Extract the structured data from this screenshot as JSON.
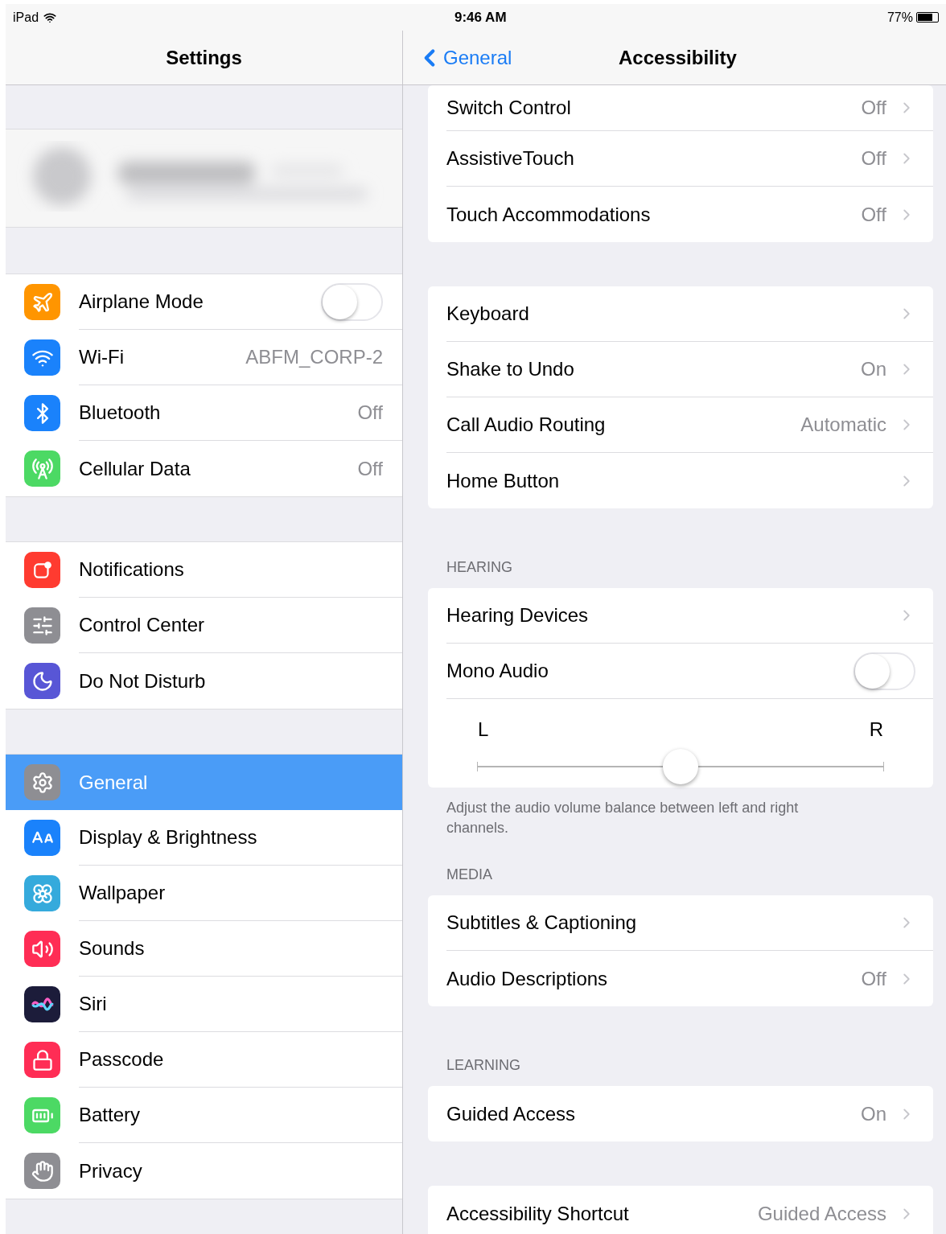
{
  "status_bar": {
    "device": "iPad",
    "time": "9:46 AM",
    "battery": "77%"
  },
  "sidebar": {
    "title": "Settings",
    "groups": [
      [
        {
          "kind": "toggle",
          "label": "Airplane Mode",
          "on": false,
          "selected": false
        },
        {
          "kind": "value",
          "label": "Wi-Fi",
          "value": "ABFM_CORP-2",
          "selected": false
        },
        {
          "kind": "value",
          "label": "Bluetooth",
          "value": "Off",
          "selected": false
        },
        {
          "kind": "value",
          "label": "Cellular Data",
          "value": "Off",
          "selected": false
        }
      ],
      [
        {
          "kind": "plain",
          "label": "Notifications",
          "selected": false
        },
        {
          "kind": "plain",
          "label": "Control Center",
          "selected": false
        },
        {
          "kind": "plain",
          "label": "Do Not Disturb",
          "selected": false
        }
      ],
      [
        {
          "kind": "plain",
          "label": "General",
          "selected": true
        },
        {
          "kind": "plain",
          "label": "Display & Brightness",
          "selected": false
        },
        {
          "kind": "plain",
          "label": "Wallpaper",
          "selected": false
        },
        {
          "kind": "plain",
          "label": "Sounds",
          "selected": false
        },
        {
          "kind": "plain",
          "label": "Siri",
          "selected": false
        },
        {
          "kind": "plain",
          "label": "Passcode",
          "selected": false
        },
        {
          "kind": "plain",
          "label": "Battery",
          "selected": false
        },
        {
          "kind": "plain",
          "label": "Privacy",
          "selected": false
        }
      ]
    ]
  },
  "nav": {
    "back": "General",
    "title": "Accessibility"
  },
  "sections": [
    {
      "rows": [
        {
          "kind": "link",
          "label": "Switch Control",
          "value": "Off"
        },
        {
          "kind": "link",
          "label": "AssistiveTouch",
          "value": "Off"
        },
        {
          "kind": "link",
          "label": "Touch Accommodations",
          "value": "Off"
        }
      ]
    },
    {
      "rows": [
        {
          "kind": "link",
          "label": "Keyboard"
        },
        {
          "kind": "link",
          "label": "Shake to Undo",
          "value": "On"
        },
        {
          "kind": "link",
          "label": "Call Audio Routing",
          "value": "Automatic"
        },
        {
          "kind": "link",
          "label": "Home Button"
        }
      ]
    },
    {
      "header": "HEARING",
      "rows": [
        {
          "kind": "link",
          "label": "Hearing Devices"
        },
        {
          "kind": "toggle",
          "label": "Mono Audio",
          "on": false
        },
        {
          "kind": "slider",
          "left": "L",
          "right": "R",
          "level": 0.5
        }
      ],
      "footer": "Adjust the audio volume balance between left and right channels."
    },
    {
      "header": "MEDIA",
      "rows": [
        {
          "kind": "link",
          "label": "Subtitles & Captioning"
        },
        {
          "kind": "link",
          "label": "Audio Descriptions",
          "value": "Off"
        }
      ]
    },
    {
      "header": "LEARNING",
      "rows": [
        {
          "kind": "link",
          "label": "Guided Access",
          "value": "On"
        }
      ]
    },
    {
      "rows": [
        {
          "kind": "link",
          "label": "Accessibility Shortcut",
          "value": "Guided Access"
        }
      ]
    }
  ]
}
